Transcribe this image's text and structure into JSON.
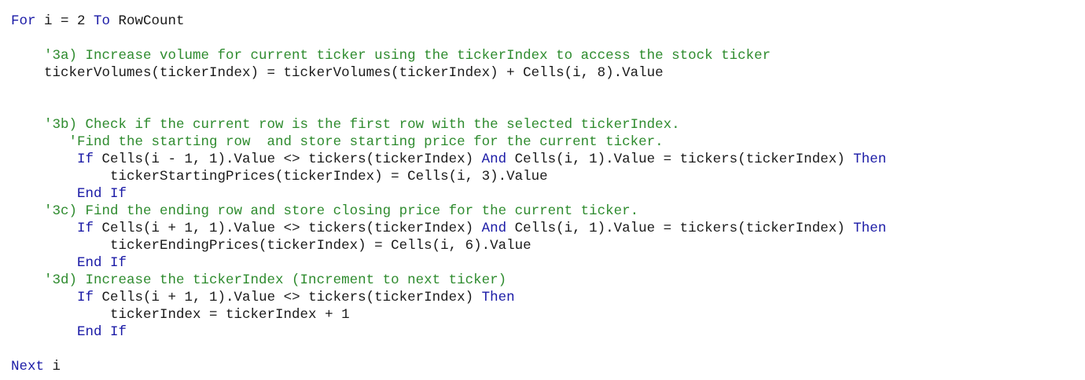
{
  "colors": {
    "keyword": "#1a1aa6",
    "comment": "#2e8b2e",
    "text": "#1a1a1a",
    "background": "#ffffff"
  },
  "code_lines": [
    [
      {
        "t": "For",
        "c": "kw"
      },
      {
        "t": " i = 2 ",
        "c": "tx"
      },
      {
        "t": "To",
        "c": "kw"
      },
      {
        "t": " RowCount",
        "c": "tx"
      }
    ],
    [],
    [
      {
        "t": "    '3a) Increase volume for current ticker using the tickerIndex to access the stock ticker",
        "c": "cm"
      }
    ],
    [
      {
        "t": "    tickerVolumes(tickerIndex) = tickerVolumes(tickerIndex) + Cells(i, 8).Value",
        "c": "tx"
      }
    ],
    [],
    [],
    [
      {
        "t": "    '3b) Check if the current row is the first row with the selected tickerIndex.",
        "c": "cm"
      }
    ],
    [
      {
        "t": "       'Find the starting row  and store starting price for the current ticker.",
        "c": "cm"
      }
    ],
    [
      {
        "t": "        ",
        "c": "tx"
      },
      {
        "t": "If",
        "c": "kw"
      },
      {
        "t": " Cells(i - 1, 1).Value <> tickers(tickerIndex) ",
        "c": "tx"
      },
      {
        "t": "And",
        "c": "kw"
      },
      {
        "t": " Cells(i, 1).Value = tickers(tickerIndex) ",
        "c": "tx"
      },
      {
        "t": "Then",
        "c": "kw"
      }
    ],
    [
      {
        "t": "            tickerStartingPrices(tickerIndex) = Cells(i, 3).Value",
        "c": "tx"
      }
    ],
    [
      {
        "t": "        ",
        "c": "tx"
      },
      {
        "t": "End If",
        "c": "kw"
      }
    ],
    [
      {
        "t": "    '3c) Find the ending row and store closing price for the current ticker.",
        "c": "cm"
      }
    ],
    [
      {
        "t": "        ",
        "c": "tx"
      },
      {
        "t": "If",
        "c": "kw"
      },
      {
        "t": " Cells(i + 1, 1).Value <> tickers(tickerIndex) ",
        "c": "tx"
      },
      {
        "t": "And",
        "c": "kw"
      },
      {
        "t": " Cells(i, 1).Value = tickers(tickerIndex) ",
        "c": "tx"
      },
      {
        "t": "Then",
        "c": "kw"
      }
    ],
    [
      {
        "t": "            tickerEndingPrices(tickerIndex) = Cells(i, 6).Value",
        "c": "tx"
      }
    ],
    [
      {
        "t": "        ",
        "c": "tx"
      },
      {
        "t": "End If",
        "c": "kw"
      }
    ],
    [
      {
        "t": "    '3d) Increase the tickerIndex (Increment to next ticker)",
        "c": "cm"
      }
    ],
    [
      {
        "t": "        ",
        "c": "tx"
      },
      {
        "t": "If",
        "c": "kw"
      },
      {
        "t": " Cells(i + 1, 1).Value <> tickers(tickerIndex) ",
        "c": "tx"
      },
      {
        "t": "Then",
        "c": "kw"
      }
    ],
    [
      {
        "t": "            tickerIndex = tickerIndex + 1",
        "c": "tx"
      }
    ],
    [
      {
        "t": "        ",
        "c": "tx"
      },
      {
        "t": "End If",
        "c": "kw"
      }
    ],
    [],
    [
      {
        "t": "Next",
        "c": "kw"
      },
      {
        "t": " i",
        "c": "tx"
      }
    ]
  ]
}
